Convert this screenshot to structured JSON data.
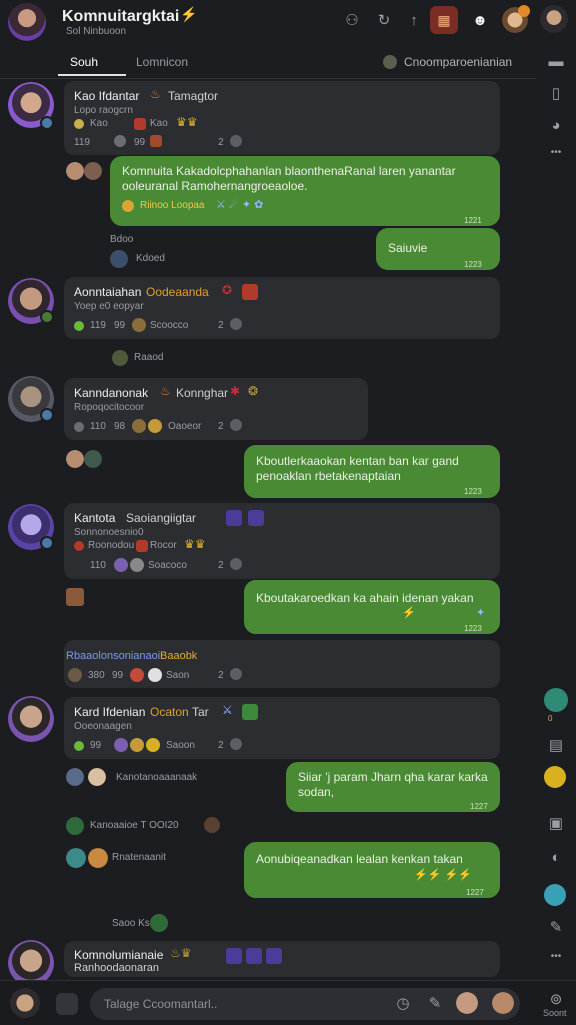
{
  "header": {
    "title": "Komnuitargktai",
    "subtitle": "Sol  Ninbuoon",
    "tab_active": "Souh",
    "tab_other": "Lomnicon",
    "tab_right": "Cnoomparoenianian"
  },
  "posts": [
    {
      "name": "Kao Ifdantar",
      "tag": "Tamagtor",
      "sub": "Lopo raogcrn",
      "stat_a": "Kao",
      "stat_count": "119",
      "stat_right": "2"
    },
    {
      "name": "Aonntaiahan",
      "tag": "Oodeaanda",
      "sub": "Yoep e0 eopyar",
      "stat_a": "Scoocco",
      "stat_count": "119",
      "stat_num": "99",
      "stat_right": "2"
    },
    {
      "name": "Kanndanonak",
      "tag": "Konnghar",
      "sub": "Ropoqocitocoor",
      "stat_a": "Oaoeor",
      "stat_count": "110",
      "stat_num": "98",
      "stat_right": "2"
    },
    {
      "name": "Kantota",
      "tag": "Saoiangiigtar",
      "sub": "Sonnonoesnio0",
      "stat_a": "Soacoco",
      "stat_count": "110",
      "stat_right": "2",
      "badge_a": "Roonodou",
      "badge_b": "Rocor"
    },
    {
      "name": "Kard Ifdenian",
      "tag": "Ocaton",
      "tag2": "Tar",
      "sub": "Ooeonaagen",
      "stat_a": "Saoon",
      "stat_count": "99",
      "stat_right": "2"
    },
    {
      "name": "Komnolumianaie",
      "sub": "Ranhoodaonaran"
    }
  ],
  "bubbles": [
    {
      "text": "Komnuita Kakadolcphahanlan blaonthenaRanal laren yanantar ooleuranal Ramohernangroeaoloe.",
      "links": "Riinoo Loopaa",
      "time": "1221"
    },
    {
      "text": "Saiuvie",
      "time": "1223"
    },
    {
      "text": "Kboutlerkaaokan kentan ban kar gand penoaklan rbetakenaptaian",
      "time": "1223"
    },
    {
      "text": "Kboutakaroedkan ka ahain idenan yakan",
      "time": "1223"
    },
    {
      "text": "Siiar 'j param Jharn qha karar karka sodan,",
      "time": "1227"
    },
    {
      "text": "Aonubiqeanadkan lealan kenkan takan",
      "time": "1227"
    }
  ],
  "replies": [
    {
      "label": "Bdoo"
    },
    {
      "label": "Kdoed"
    },
    {
      "label": "Raaod"
    },
    {
      "label": "Kanotanoaaanaak"
    },
    {
      "label": "Kanoaaioe  T  OOI20"
    },
    {
      "label": "Rnatenaanit"
    },
    {
      "label": "Saoo  Ksos"
    }
  ],
  "system_line": {
    "text": "Rbaaolonsonianaoi",
    "suffix": "Baaobk",
    "count_a": "380",
    "count_b": "99",
    "stat": "Saon",
    "right": "2"
  },
  "composer": {
    "placeholder": "Talage Ccoomantarl..",
    "label_right": "Soont"
  },
  "colors": {
    "accent_green": "#4a8a35",
    "card": "#2b2d31",
    "bg": "#1c1d20"
  }
}
